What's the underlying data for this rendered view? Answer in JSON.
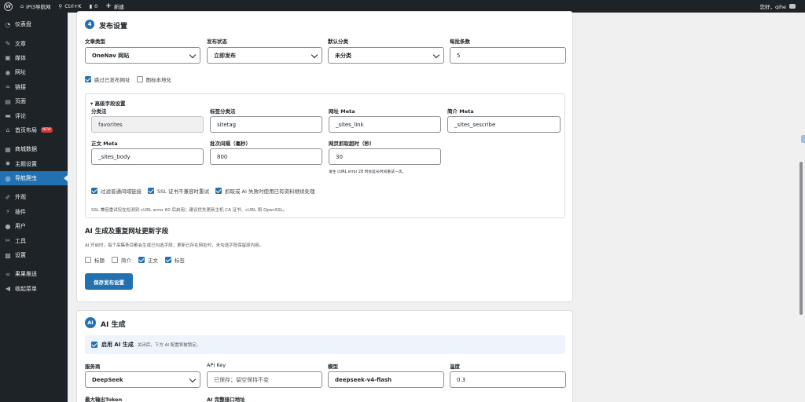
{
  "adminbar": {
    "site_name": "IPI3导航网",
    "shortcut": "Ctrl+K",
    "comments_count": "0",
    "new_label": "新建",
    "greeting": "您好，qihe"
  },
  "sidebar": {
    "items": [
      {
        "label": "仪表盘",
        "icon": "dashboard-icon"
      },
      {
        "label": "文章",
        "icon": "pin-icon"
      },
      {
        "label": "媒体",
        "icon": "media-icon"
      },
      {
        "label": "网址",
        "icon": "globe-icon"
      },
      {
        "label": "链接",
        "icon": "link-icon"
      },
      {
        "label": "页面",
        "icon": "page-icon"
      },
      {
        "label": "评论",
        "icon": "comment-icon"
      },
      {
        "label": "首页布局",
        "icon": "home-icon",
        "badge": "NEW"
      },
      {
        "label": "商城数据",
        "icon": "cart-icon"
      },
      {
        "label": "主题设置",
        "icon": "gear-icon"
      },
      {
        "label": "导航爬虫",
        "icon": "globe-icon",
        "active": true
      },
      {
        "label": "外观",
        "icon": "brush-icon"
      },
      {
        "label": "插件",
        "icon": "plugin-icon"
      },
      {
        "label": "用户",
        "icon": "user-icon"
      },
      {
        "label": "工具",
        "icon": "wrench-icon"
      },
      {
        "label": "设置",
        "icon": "settings-icon"
      },
      {
        "label": "果果推送",
        "icon": "link-icon"
      },
      {
        "label": "收起菜单",
        "icon": "collapse-icon"
      }
    ]
  },
  "publish": {
    "step": "4",
    "title": "发布设置",
    "post_type_label": "文章类型",
    "post_type_value": "OneNav 网站",
    "status_label": "发布状态",
    "status_value": "立即发布",
    "category_label": "默认分类",
    "category_value": "未分类",
    "batch_label": "每批条数",
    "batch_value": "5",
    "skip_published": "跳过已发布网址",
    "localize_icons": "图标本地化"
  },
  "advanced": {
    "summary": "▾ 高级字段设置",
    "taxonomy_label": "分类法",
    "taxonomy_value": "favorites",
    "tag_tax_label": "标签分类法",
    "tag_tax_value": "sitetag",
    "url_meta_label": "网址 Meta",
    "url_meta_value": "_sites_link",
    "intro_meta_label": "简介 Meta",
    "intro_meta_value": "_sites_sescribe",
    "body_meta_label": "正文 Meta",
    "body_meta_value": "_sites_body",
    "interval_label": "批次间隔（毫秒）",
    "interval_value": "800",
    "timeout_label": "网页抓取超时（秒）",
    "timeout_value": "30",
    "timeout_hint": "发生 cURL error 28 时会延长时间重试一次。",
    "opt_filter": "过滤普通间域链接",
    "opt_ssl": "SSL 证书不兼容时重试",
    "opt_fail": "抓取或 AI 失败时使用已有资料继续处理",
    "ssl_note": "SSL 兼容重试仅在检测到 cURL error 60 后启用；建议优先更新主机 CA 证书、cURL 和 OpenSSL。"
  },
  "ai_update": {
    "title": "AI 生成及重复网址更新字段",
    "desc": "AI 开启时，每个采集条目都会生成已勾选字段；更新已存在网址时，未勾选字段保留原内容。",
    "fields": [
      {
        "label": "标题",
        "checked": false
      },
      {
        "label": "简介",
        "checked": false
      },
      {
        "label": "正文",
        "checked": true
      },
      {
        "label": "标签",
        "checked": true
      }
    ],
    "save_label": "保存发布设置"
  },
  "ai": {
    "badge": "AI",
    "title": "AI 生成",
    "enable_label": "启用 AI 生成",
    "enable_hint": "关闭后，下方 AI 配置将被锁定。",
    "provider_label": "服务商",
    "provider_value": "DeepSeek",
    "apikey_label": "API Key",
    "apikey_placeholder": "已保存；留空保持不变",
    "model_label": "模型",
    "model_value": "deepseek-v4-flash",
    "temp_label": "温度",
    "temp_value": "0.3",
    "max_token_label": "最大输出Token",
    "endpoint_label": "AI 完整接口地址"
  }
}
